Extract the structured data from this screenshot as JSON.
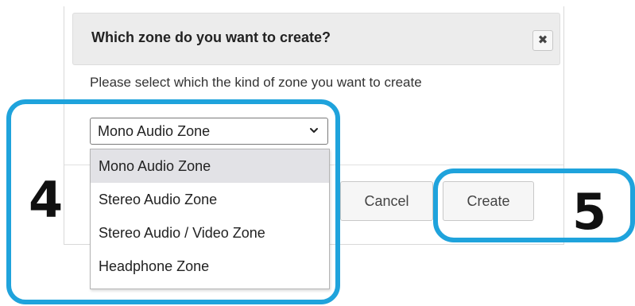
{
  "dialog": {
    "title": "Which zone do you want to create?",
    "close_label": "✖",
    "message": "Please select which the kind of zone you want to create",
    "cancel_label": "Cancel",
    "create_label": "Create"
  },
  "select": {
    "value": "Mono Audio Zone",
    "chevron_icon": "chevron-down-icon",
    "options": [
      "Mono Audio Zone",
      "Stereo Audio Zone",
      "Stereo Audio / Video Zone",
      "Headphone Zone"
    ],
    "highlighted_index": 0
  },
  "annotations": {
    "step_4": "4",
    "step_5": "5",
    "color": "#1fa3dc"
  }
}
